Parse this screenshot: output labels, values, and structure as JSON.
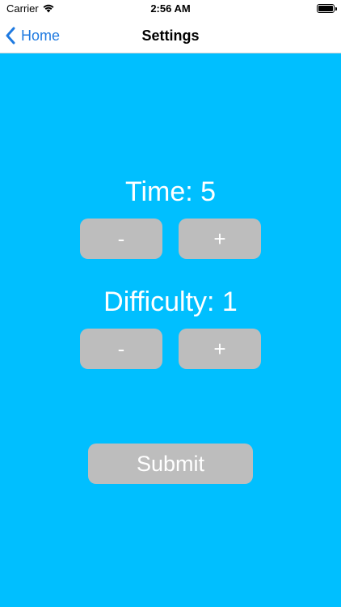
{
  "status_bar": {
    "carrier": "Carrier",
    "time": "2:56 AM",
    "icons": [
      "wifi-icon",
      "battery-icon"
    ]
  },
  "nav": {
    "back_label": "Home",
    "title": "Settings",
    "back_icon": "chevron-left-icon"
  },
  "settings": {
    "time_label": "Time: 5",
    "difficulty_label": "Difficulty: 1",
    "time_decrement_label": "-",
    "time_increment_label": "+",
    "difficulty_decrement_label": "-",
    "difficulty_increment_label": "+",
    "submit_label": "Submit"
  },
  "colors": {
    "background": "#00bfff",
    "button": "#bdbdbd",
    "button_text": "#ffffff",
    "accent": "#1f7ae0"
  }
}
